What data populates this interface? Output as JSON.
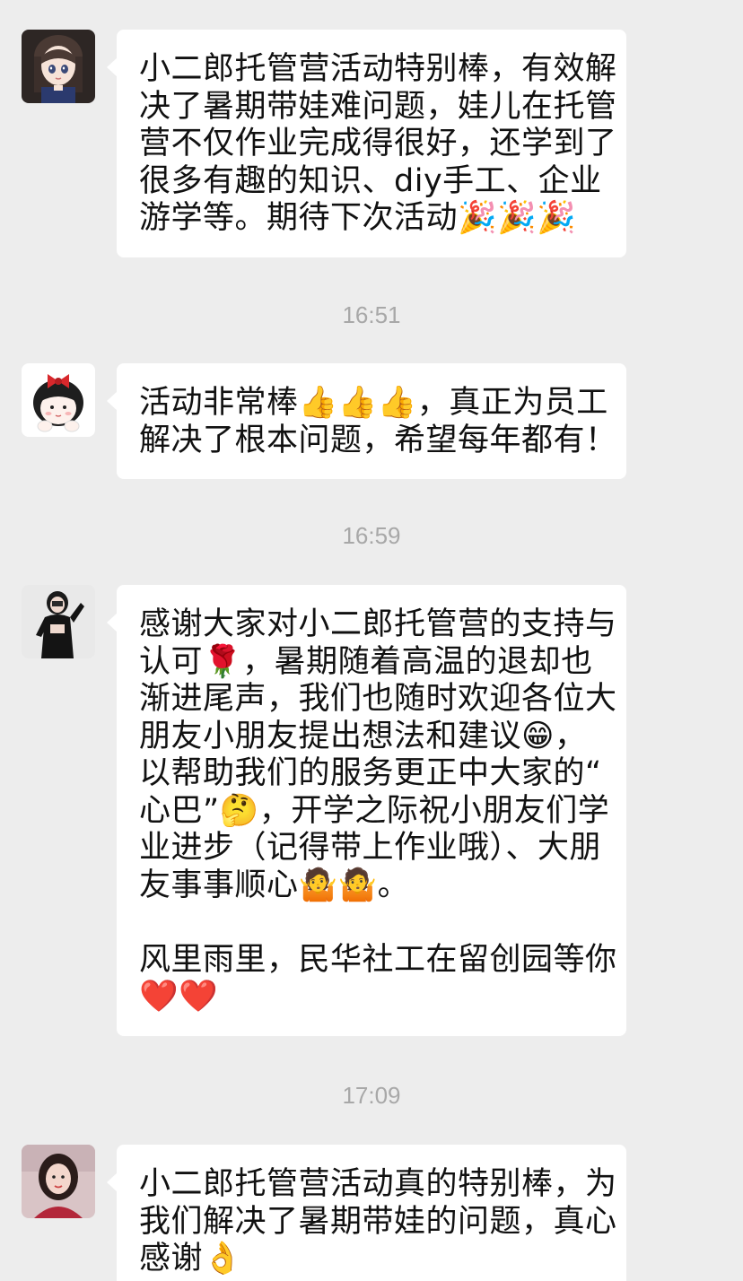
{
  "messages": [
    {
      "avatar": "girl-with-dark-hair-avatar",
      "lines": [
        "小二郎托管营活动特别棒，有效解",
        "决了暑期带娃难问题，娃儿在托管",
        "营不仅作业完成得很好，还学到了",
        "很多有趣的知识、diy手工、企业",
        "游学等。期待下次活动🎉🎉🎉"
      ]
    },
    {
      "timestamp": "16:51",
      "avatar": "cartoon-girl-with-red-bow-avatar",
      "lines": [
        "活动非常棒👍👍👍，真正为员工",
        "解决了根本问题，希望每年都有！"
      ]
    },
    {
      "timestamp": "16:59",
      "avatar": "woman-in-black-avatar",
      "lines": [
        "感谢大家对小二郎托管营的支持与",
        "认可🌹，暑期随着高温的退却也",
        "渐进尾声，我们也随时欢迎各位大",
        "朋友小朋友提出想法和建议😁，",
        "以帮助我们的服务更正中大家的“",
        "心巴”🤔，开学之际祝小朋友们学",
        "业进步（记得带上作业哦）、大朋",
        "友事事顺心🤷🤷。",
        "",
        "风里雨里，民华社工在留创园等你",
        "❤️❤️"
      ]
    },
    {
      "timestamp": "17:09",
      "avatar": "selfie-woman-avatar",
      "lines": [
        "小二郎托管营活动真的特别棒，为",
        "我们解决了暑期带娃的问题，真心",
        "感谢👌"
      ]
    }
  ],
  "colors": {
    "background": "#ededed",
    "bubble": "#ffffff",
    "timestamp": "#a8a8a8",
    "text": "#111111"
  }
}
